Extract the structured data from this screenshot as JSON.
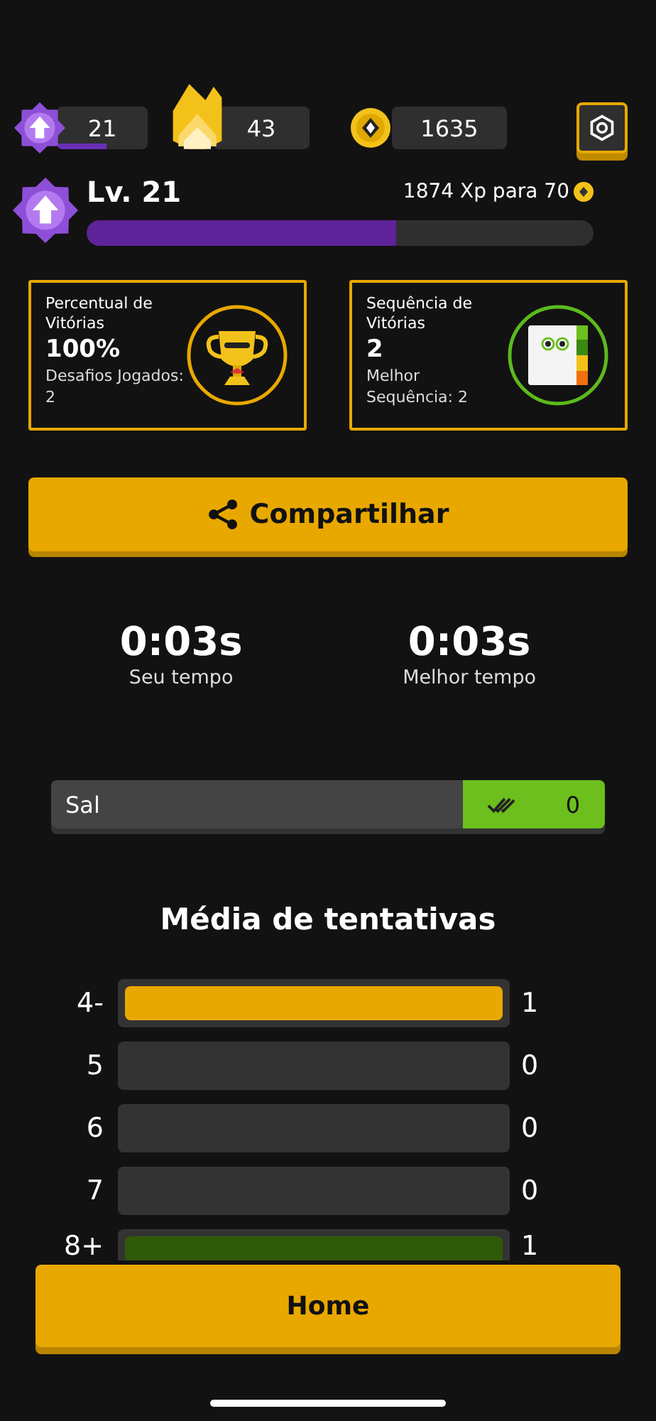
{
  "stats": {
    "level_chip": {
      "value": "21",
      "level": 0.55
    },
    "streak": "43",
    "coins": "1635"
  },
  "level_panel": {
    "title": "Lv. 21",
    "xp_text": "1874 Xp para 70",
    "level": 0.61
  },
  "cards": [
    {
      "kind": "trophy",
      "title": "Percentual de Vitórias",
      "value": "100%",
      "note": "Desafios Jogados: 2"
    },
    {
      "kind": "notebook",
      "title": "Sequência de Vitórias",
      "value": "2",
      "note": "Melhor Sequência: 2"
    }
  ],
  "share_button": "Compartilhar",
  "times": [
    {
      "value": "0:03s",
      "label": "Seu tempo"
    },
    {
      "value": "0:03s",
      "label": "Melhor tempo"
    }
  ],
  "word": {
    "text": "Sal",
    "count": "0"
  },
  "attempts": {
    "title": "Média de tentativas",
    "rows": [
      {
        "label": "4-",
        "count": "1",
        "level": 1,
        "color": "#e8a800"
      },
      {
        "label": "5",
        "count": "0"
      },
      {
        "label": "6",
        "count": "0"
      },
      {
        "label": "7",
        "count": "0"
      },
      {
        "label": "8+",
        "count": "1",
        "level": 1,
        "color": "#2f5a0a"
      }
    ]
  },
  "home_button": "Home"
}
